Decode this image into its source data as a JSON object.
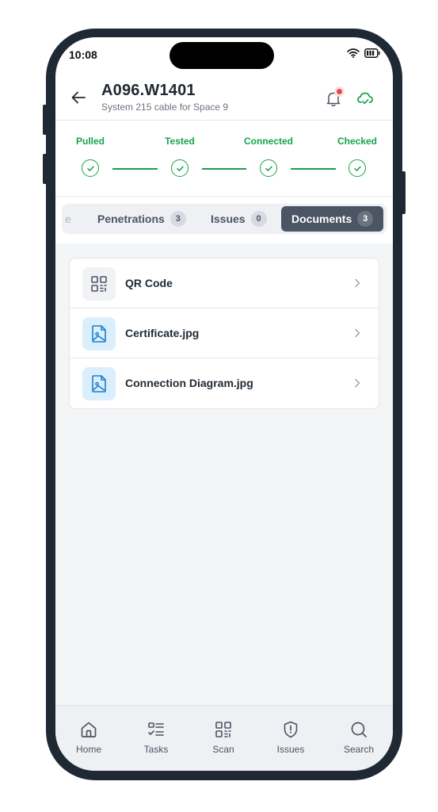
{
  "status": {
    "time": "10:08"
  },
  "header": {
    "title": "A096.W1401",
    "subtitle": "System 215 cable for Space 9"
  },
  "steps": [
    {
      "label": "Pulled",
      "done": true
    },
    {
      "label": "Tested",
      "done": true
    },
    {
      "label": "Connected",
      "done": true
    },
    {
      "label": "Checked",
      "done": true
    }
  ],
  "tabs": {
    "partial_label": "e",
    "items": [
      {
        "label": "Penetrations",
        "count": "3"
      },
      {
        "label": "Issues",
        "count": "0"
      },
      {
        "label": "Documents",
        "count": "3",
        "active": true
      }
    ]
  },
  "documents": [
    {
      "name": "QR Code",
      "icon": "qr-code-icon"
    },
    {
      "name": "Certificate.jpg",
      "icon": "image-file-icon"
    },
    {
      "name": "Connection Diagram.jpg",
      "icon": "image-file-icon"
    }
  ],
  "nav": [
    {
      "label": "Home",
      "icon": "home-icon"
    },
    {
      "label": "Tasks",
      "icon": "tasks-icon"
    },
    {
      "label": "Scan",
      "icon": "qr-scan-icon"
    },
    {
      "label": "Issues",
      "icon": "shield-alert-icon"
    },
    {
      "label": "Search",
      "icon": "search-icon"
    }
  ],
  "colors": {
    "accent_green": "#16a34a",
    "active_tab": "#4b5563",
    "notification_dot": "#ef4444",
    "doc_icon_blue": "#1d7fd1"
  }
}
